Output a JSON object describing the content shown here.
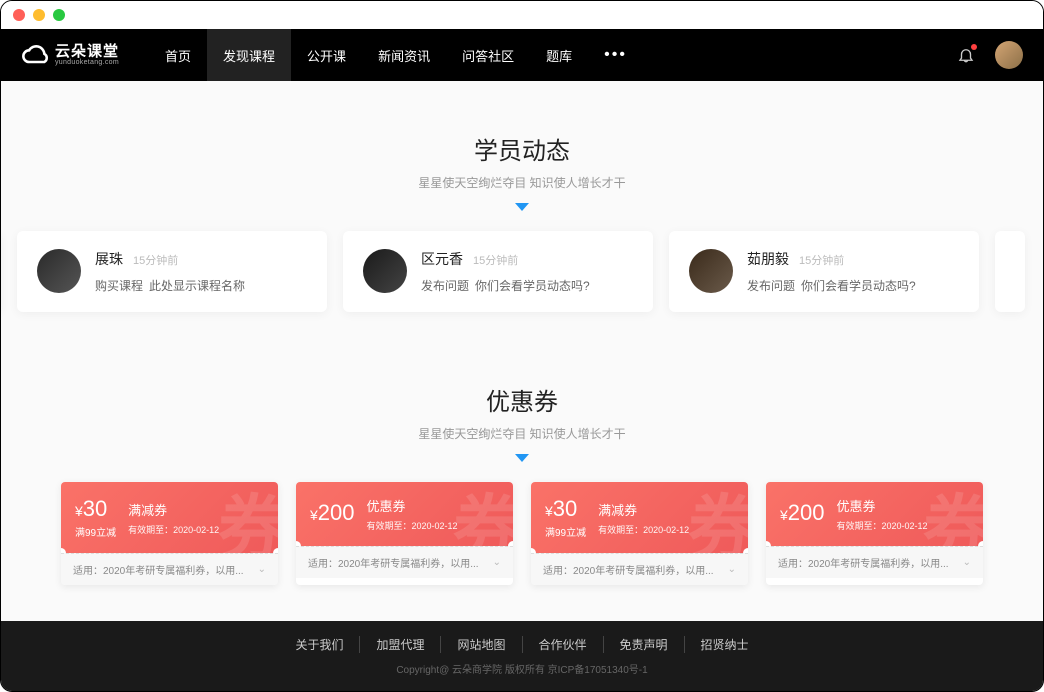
{
  "logo": {
    "main": "云朵课堂",
    "sub": "yunduoketang.com"
  },
  "nav": {
    "items": [
      "首页",
      "发现课程",
      "公开课",
      "新闻资讯",
      "问答社区",
      "题库"
    ],
    "active_index": 1,
    "more": "•••"
  },
  "sections": {
    "activity": {
      "title": "学员动态",
      "subtitle": "星星使天空绚烂夺目  知识使人增长才干",
      "cards": [
        {
          "name": "展珠",
          "time": "15分钟前",
          "tag": "购买课程",
          "desc": "此处显示课程名称"
        },
        {
          "name": "区元香",
          "time": "15分钟前",
          "tag": "发布问题",
          "desc": "你们会看学员动态吗?"
        },
        {
          "name": "茹朋毅",
          "time": "15分钟前",
          "tag": "发布问题",
          "desc": "你们会看学员动态吗?"
        }
      ]
    },
    "coupons": {
      "title": "优惠券",
      "subtitle": "星星使天空绚烂夺目  知识使人增长才干",
      "items": [
        {
          "amount": "30",
          "condition": "满99立减",
          "type": "满减券",
          "expire": "有效期至：2020-02-12",
          "apply": "适用：2020年考研专属福利券，以用..."
        },
        {
          "amount": "200",
          "condition": "",
          "type": "优惠券",
          "expire": "有效期至：2020-02-12",
          "apply": "适用：2020年考研专属福利券，以用..."
        },
        {
          "amount": "30",
          "condition": "满99立减",
          "type": "满减券",
          "expire": "有效期至：2020-02-12",
          "apply": "适用：2020年考研专属福利券，以用..."
        },
        {
          "amount": "200",
          "condition": "",
          "type": "优惠券",
          "expire": "有效期至：2020-02-12",
          "apply": "适用：2020年考研专属福利券，以用..."
        }
      ],
      "bg_char": "券"
    }
  },
  "footer": {
    "links": [
      "关于我们",
      "加盟代理",
      "网站地图",
      "合作伙伴",
      "免责声明",
      "招贤纳士"
    ],
    "copyright": "Copyright@  云朵商学院   版权所有      京ICP备17051340号-1"
  }
}
